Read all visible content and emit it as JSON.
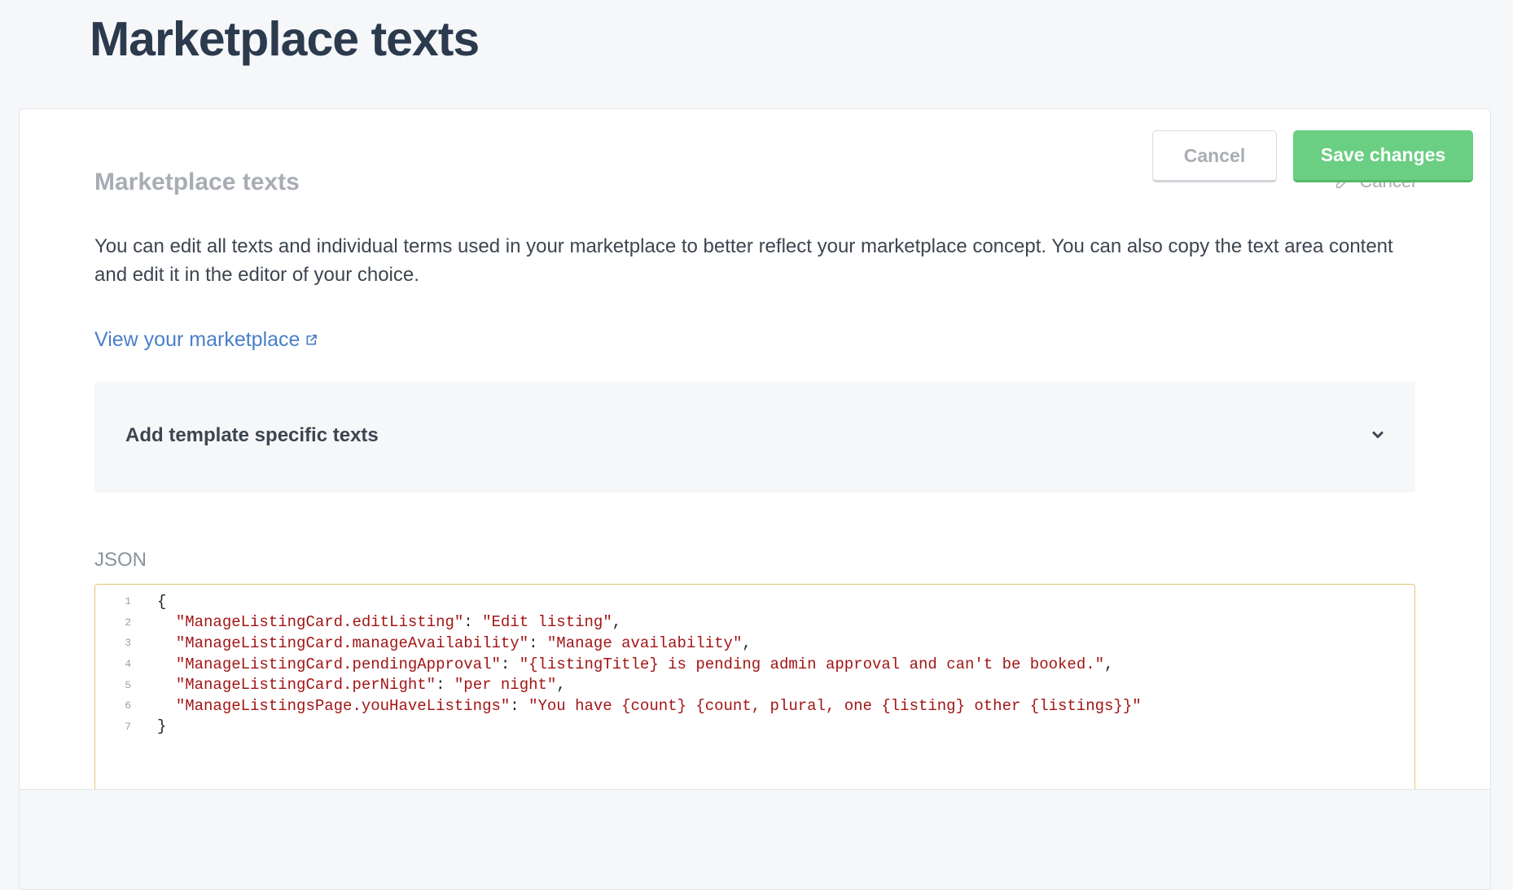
{
  "page": {
    "title": "Marketplace texts"
  },
  "section": {
    "title": "Marketplace texts",
    "edit_cancel_label": "Cancel",
    "edit_cancel_icon": "pencil-icon",
    "description": "You can edit all texts and individual terms used in your marketplace to better reflect your marketplace concept. You can also copy the text area content and edit it in the editor of your choice.",
    "view_link_label": "View your marketplace",
    "view_link_icon": "external-link-icon"
  },
  "accordion": {
    "label": "Add template specific texts",
    "icon": "chevron-down-icon"
  },
  "editor": {
    "label": "JSON",
    "lines": [
      {
        "num": "1",
        "key": "",
        "value": "",
        "open": "{",
        "trail": ""
      },
      {
        "num": "2",
        "key": "\"ManageListingCard.editListing\"",
        "value": "\"Edit listing\"",
        "open": "",
        "trail": ","
      },
      {
        "num": "3",
        "key": "\"ManageListingCard.manageAvailability\"",
        "value": "\"Manage availability\"",
        "open": "",
        "trail": ","
      },
      {
        "num": "4",
        "key": "\"ManageListingCard.pendingApproval\"",
        "value": "\"{listingTitle} is pending admin approval and can't be booked.\"",
        "open": "",
        "trail": ","
      },
      {
        "num": "5",
        "key": "\"ManageListingCard.perNight\"",
        "value": "\"per night\"",
        "open": "",
        "trail": ","
      },
      {
        "num": "6",
        "key": "\"ManageListingsPage.youHaveListings\"",
        "value": "\"You have {count} {count, plural, one {listing} other {listings}}\"",
        "open": "",
        "trail": ""
      },
      {
        "num": "7",
        "key": "",
        "value": "",
        "open": "}",
        "trail": ""
      }
    ]
  },
  "footer": {
    "cancel_label": "Cancel",
    "save_label": "Save changes"
  },
  "colors": {
    "accent_link": "#4a7fc9",
    "save_button": "#6bcf83",
    "editor_border": "#e6c675",
    "code_string": "#a31515"
  }
}
